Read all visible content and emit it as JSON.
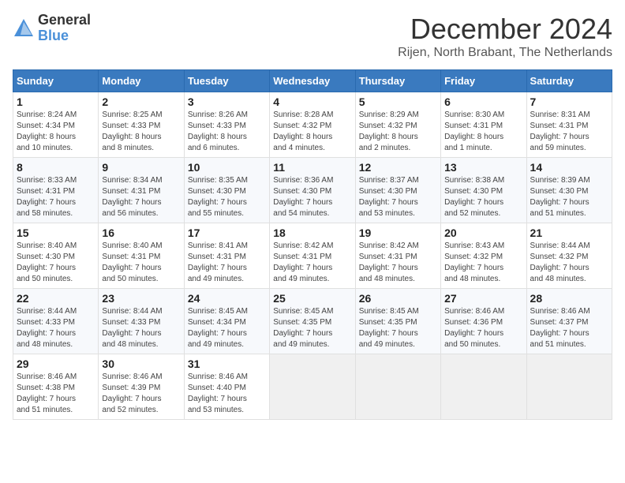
{
  "header": {
    "logo_line1": "General",
    "logo_line2": "Blue",
    "month_title": "December 2024",
    "location": "Rijen, North Brabant, The Netherlands"
  },
  "weekdays": [
    "Sunday",
    "Monday",
    "Tuesday",
    "Wednesday",
    "Thursday",
    "Friday",
    "Saturday"
  ],
  "weeks": [
    [
      {
        "day": "1",
        "sunrise": "8:24 AM",
        "sunset": "4:34 PM",
        "daylight": "8 hours and 10 minutes."
      },
      {
        "day": "2",
        "sunrise": "8:25 AM",
        "sunset": "4:33 PM",
        "daylight": "8 hours and 8 minutes."
      },
      {
        "day": "3",
        "sunrise": "8:26 AM",
        "sunset": "4:33 PM",
        "daylight": "8 hours and 6 minutes."
      },
      {
        "day": "4",
        "sunrise": "8:28 AM",
        "sunset": "4:32 PM",
        "daylight": "8 hours and 4 minutes."
      },
      {
        "day": "5",
        "sunrise": "8:29 AM",
        "sunset": "4:32 PM",
        "daylight": "8 hours and 2 minutes."
      },
      {
        "day": "6",
        "sunrise": "8:30 AM",
        "sunset": "4:31 PM",
        "daylight": "8 hours and 1 minute."
      },
      {
        "day": "7",
        "sunrise": "8:31 AM",
        "sunset": "4:31 PM",
        "daylight": "7 hours and 59 minutes."
      }
    ],
    [
      {
        "day": "8",
        "sunrise": "8:33 AM",
        "sunset": "4:31 PM",
        "daylight": "7 hours and 58 minutes."
      },
      {
        "day": "9",
        "sunrise": "8:34 AM",
        "sunset": "4:31 PM",
        "daylight": "7 hours and 56 minutes."
      },
      {
        "day": "10",
        "sunrise": "8:35 AM",
        "sunset": "4:30 PM",
        "daylight": "7 hours and 55 minutes."
      },
      {
        "day": "11",
        "sunrise": "8:36 AM",
        "sunset": "4:30 PM",
        "daylight": "7 hours and 54 minutes."
      },
      {
        "day": "12",
        "sunrise": "8:37 AM",
        "sunset": "4:30 PM",
        "daylight": "7 hours and 53 minutes."
      },
      {
        "day": "13",
        "sunrise": "8:38 AM",
        "sunset": "4:30 PM",
        "daylight": "7 hours and 52 minutes."
      },
      {
        "day": "14",
        "sunrise": "8:39 AM",
        "sunset": "4:30 PM",
        "daylight": "7 hours and 51 minutes."
      }
    ],
    [
      {
        "day": "15",
        "sunrise": "8:40 AM",
        "sunset": "4:30 PM",
        "daylight": "7 hours and 50 minutes."
      },
      {
        "day": "16",
        "sunrise": "8:40 AM",
        "sunset": "4:31 PM",
        "daylight": "7 hours and 50 minutes."
      },
      {
        "day": "17",
        "sunrise": "8:41 AM",
        "sunset": "4:31 PM",
        "daylight": "7 hours and 49 minutes."
      },
      {
        "day": "18",
        "sunrise": "8:42 AM",
        "sunset": "4:31 PM",
        "daylight": "7 hours and 49 minutes."
      },
      {
        "day": "19",
        "sunrise": "8:42 AM",
        "sunset": "4:31 PM",
        "daylight": "7 hours and 48 minutes."
      },
      {
        "day": "20",
        "sunrise": "8:43 AM",
        "sunset": "4:32 PM",
        "daylight": "7 hours and 48 minutes."
      },
      {
        "day": "21",
        "sunrise": "8:44 AM",
        "sunset": "4:32 PM",
        "daylight": "7 hours and 48 minutes."
      }
    ],
    [
      {
        "day": "22",
        "sunrise": "8:44 AM",
        "sunset": "4:33 PM",
        "daylight": "7 hours and 48 minutes."
      },
      {
        "day": "23",
        "sunrise": "8:44 AM",
        "sunset": "4:33 PM",
        "daylight": "7 hours and 48 minutes."
      },
      {
        "day": "24",
        "sunrise": "8:45 AM",
        "sunset": "4:34 PM",
        "daylight": "7 hours and 49 minutes."
      },
      {
        "day": "25",
        "sunrise": "8:45 AM",
        "sunset": "4:35 PM",
        "daylight": "7 hours and 49 minutes."
      },
      {
        "day": "26",
        "sunrise": "8:45 AM",
        "sunset": "4:35 PM",
        "daylight": "7 hours and 49 minutes."
      },
      {
        "day": "27",
        "sunrise": "8:46 AM",
        "sunset": "4:36 PM",
        "daylight": "7 hours and 50 minutes."
      },
      {
        "day": "28",
        "sunrise": "8:46 AM",
        "sunset": "4:37 PM",
        "daylight": "7 hours and 51 minutes."
      }
    ],
    [
      {
        "day": "29",
        "sunrise": "8:46 AM",
        "sunset": "4:38 PM",
        "daylight": "7 hours and 51 minutes."
      },
      {
        "day": "30",
        "sunrise": "8:46 AM",
        "sunset": "4:39 PM",
        "daylight": "7 hours and 52 minutes."
      },
      {
        "day": "31",
        "sunrise": "8:46 AM",
        "sunset": "4:40 PM",
        "daylight": "7 hours and 53 minutes."
      },
      null,
      null,
      null,
      null
    ]
  ]
}
